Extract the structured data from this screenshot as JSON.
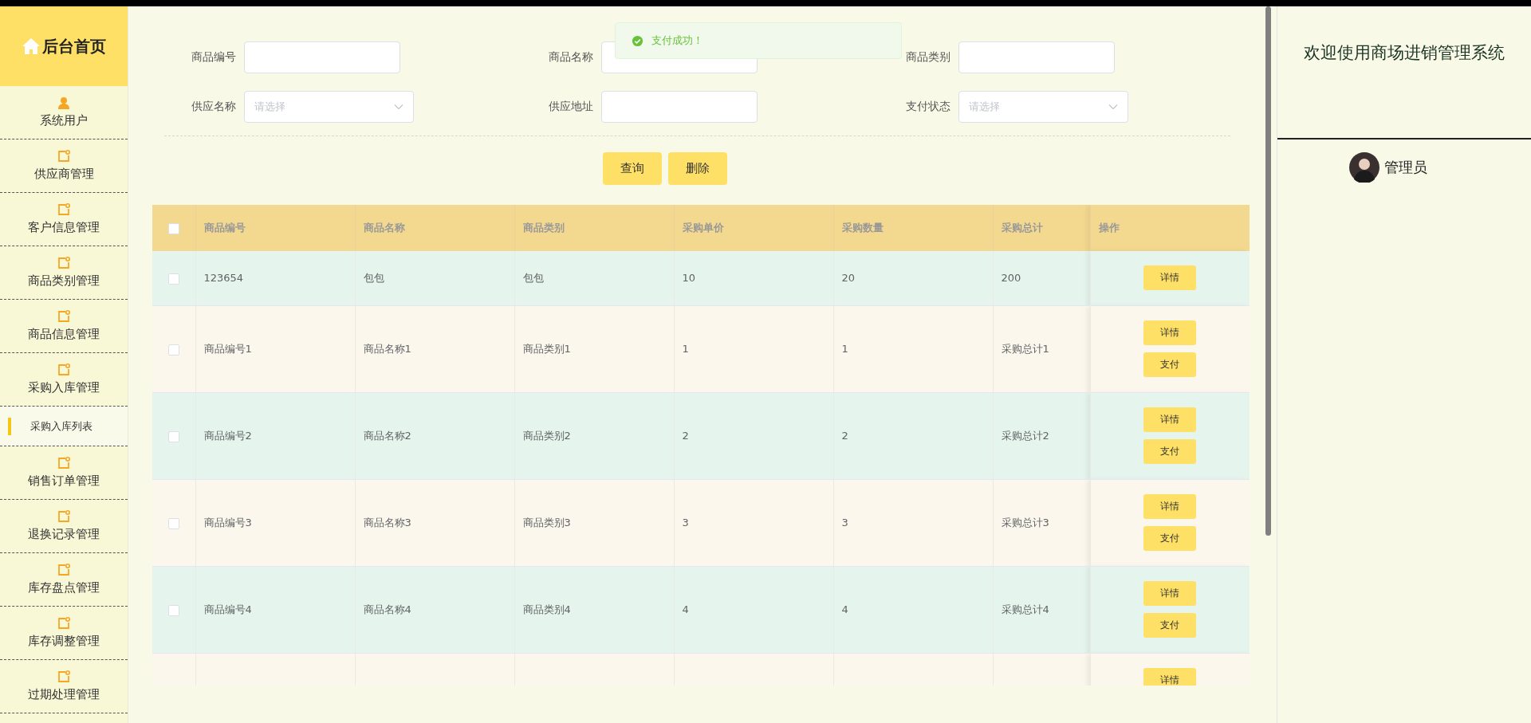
{
  "header": {
    "title": "后台首页"
  },
  "sidebar": {
    "items": [
      {
        "label": "系统用户",
        "kind": "user"
      },
      {
        "label": "供应商管理",
        "kind": "note"
      },
      {
        "label": "客户信息管理",
        "kind": "note"
      },
      {
        "label": "商品类别管理",
        "kind": "note"
      },
      {
        "label": "商品信息管理",
        "kind": "note"
      },
      {
        "label": "采购入库管理",
        "kind": "note",
        "children": [
          {
            "label": "采购入库列表",
            "selected": true
          }
        ]
      },
      {
        "label": "销售订单管理",
        "kind": "note"
      },
      {
        "label": "退换记录管理",
        "kind": "note"
      },
      {
        "label": "库存盘点管理",
        "kind": "note"
      },
      {
        "label": "库存调整管理",
        "kind": "note"
      },
      {
        "label": "过期处理管理",
        "kind": "note"
      }
    ]
  },
  "toast": {
    "message": "支付成功！",
    "kind": "success"
  },
  "search": {
    "fields": [
      {
        "label": "商品编号",
        "kind": "input"
      },
      {
        "label": "商品名称",
        "kind": "input"
      },
      {
        "label": "商品类别",
        "kind": "input"
      },
      {
        "label": "供应名称",
        "kind": "select",
        "placeholder": "请选择"
      },
      {
        "label": "供应地址",
        "kind": "input"
      },
      {
        "label": "支付状态",
        "kind": "select",
        "placeholder": "请选择"
      }
    ],
    "buttons": [
      "查询",
      "删除"
    ]
  },
  "table": {
    "all_checked": false,
    "columns": [
      "商品编号",
      "商品名称",
      "商品类别",
      "采购单价",
      "采购数量",
      "采购总计",
      "操作"
    ],
    "rows": [
      {
        "checked": false,
        "cells": [
          "123654",
          "包包",
          "包包",
          "10",
          "20",
          "200"
        ],
        "actions": [
          "详情"
        ]
      },
      {
        "checked": false,
        "cells": [
          "商品编号1",
          "商品名称1",
          "商品类别1",
          "1",
          "1",
          "采购总计1"
        ],
        "actions": [
          "详情",
          "支付"
        ]
      },
      {
        "checked": false,
        "cells": [
          "商品编号2",
          "商品名称2",
          "商品类别2",
          "2",
          "2",
          "采购总计2"
        ],
        "actions": [
          "详情",
          "支付"
        ]
      },
      {
        "checked": false,
        "cells": [
          "商品编号3",
          "商品名称3",
          "商品类别3",
          "3",
          "3",
          "采购总计3"
        ],
        "actions": [
          "详情",
          "支付"
        ]
      },
      {
        "checked": false,
        "cells": [
          "商品编号4",
          "商品名称4",
          "商品类别4",
          "4",
          "4",
          "采购总计4"
        ],
        "actions": [
          "详情",
          "支付"
        ]
      },
      {
        "actions": [
          "详情"
        ]
      }
    ]
  },
  "right_panel": {
    "title": "欢迎使用商场进销管理系统",
    "user": "管理员"
  }
}
